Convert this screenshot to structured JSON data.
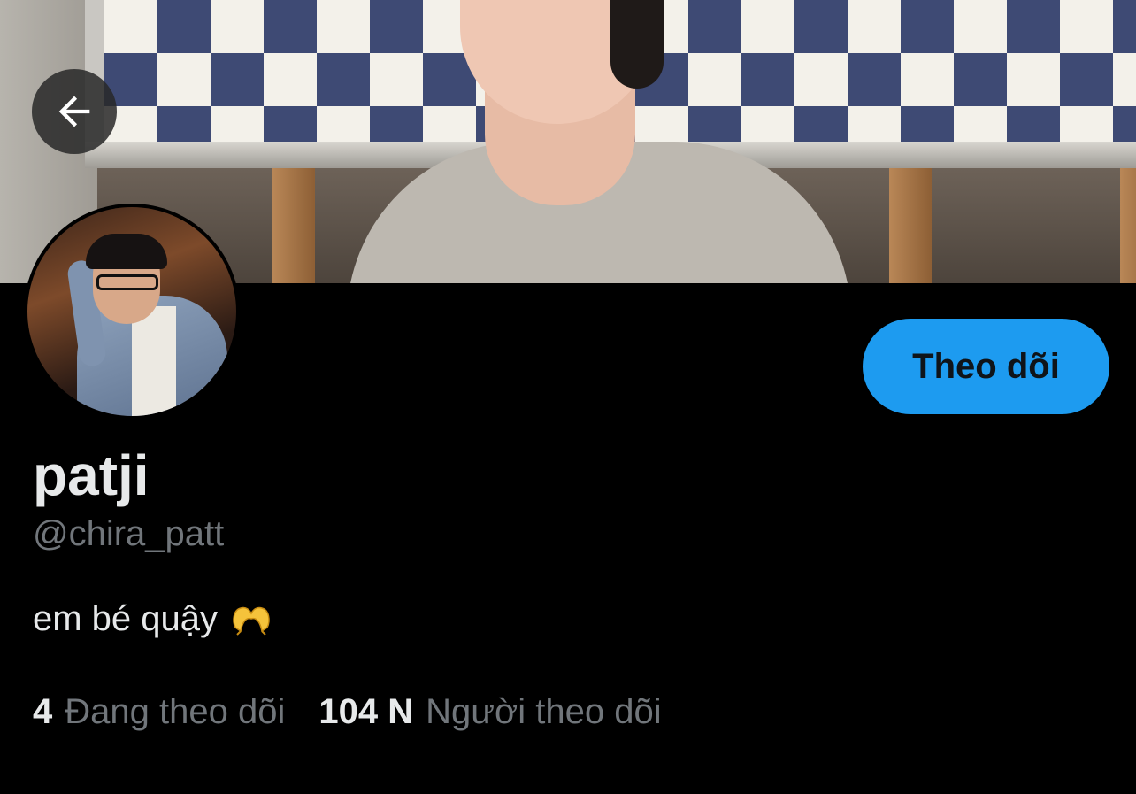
{
  "profile": {
    "display_name": "patji",
    "handle": "@chira_patt",
    "bio": "em bé quậy",
    "bio_emoji": "heart-hands-icon"
  },
  "stats": {
    "following_count": "4",
    "following_label": "Đang theo dõi",
    "followers_count": "104 N",
    "followers_label": "Người theo dõi"
  },
  "actions": {
    "follow_label": "Theo dõi",
    "back_icon": "arrow-left-icon"
  },
  "colors": {
    "background": "#000000",
    "accent": "#1d9bf0",
    "primary_text": "#e7e9ea",
    "secondary_text": "#71767b"
  }
}
